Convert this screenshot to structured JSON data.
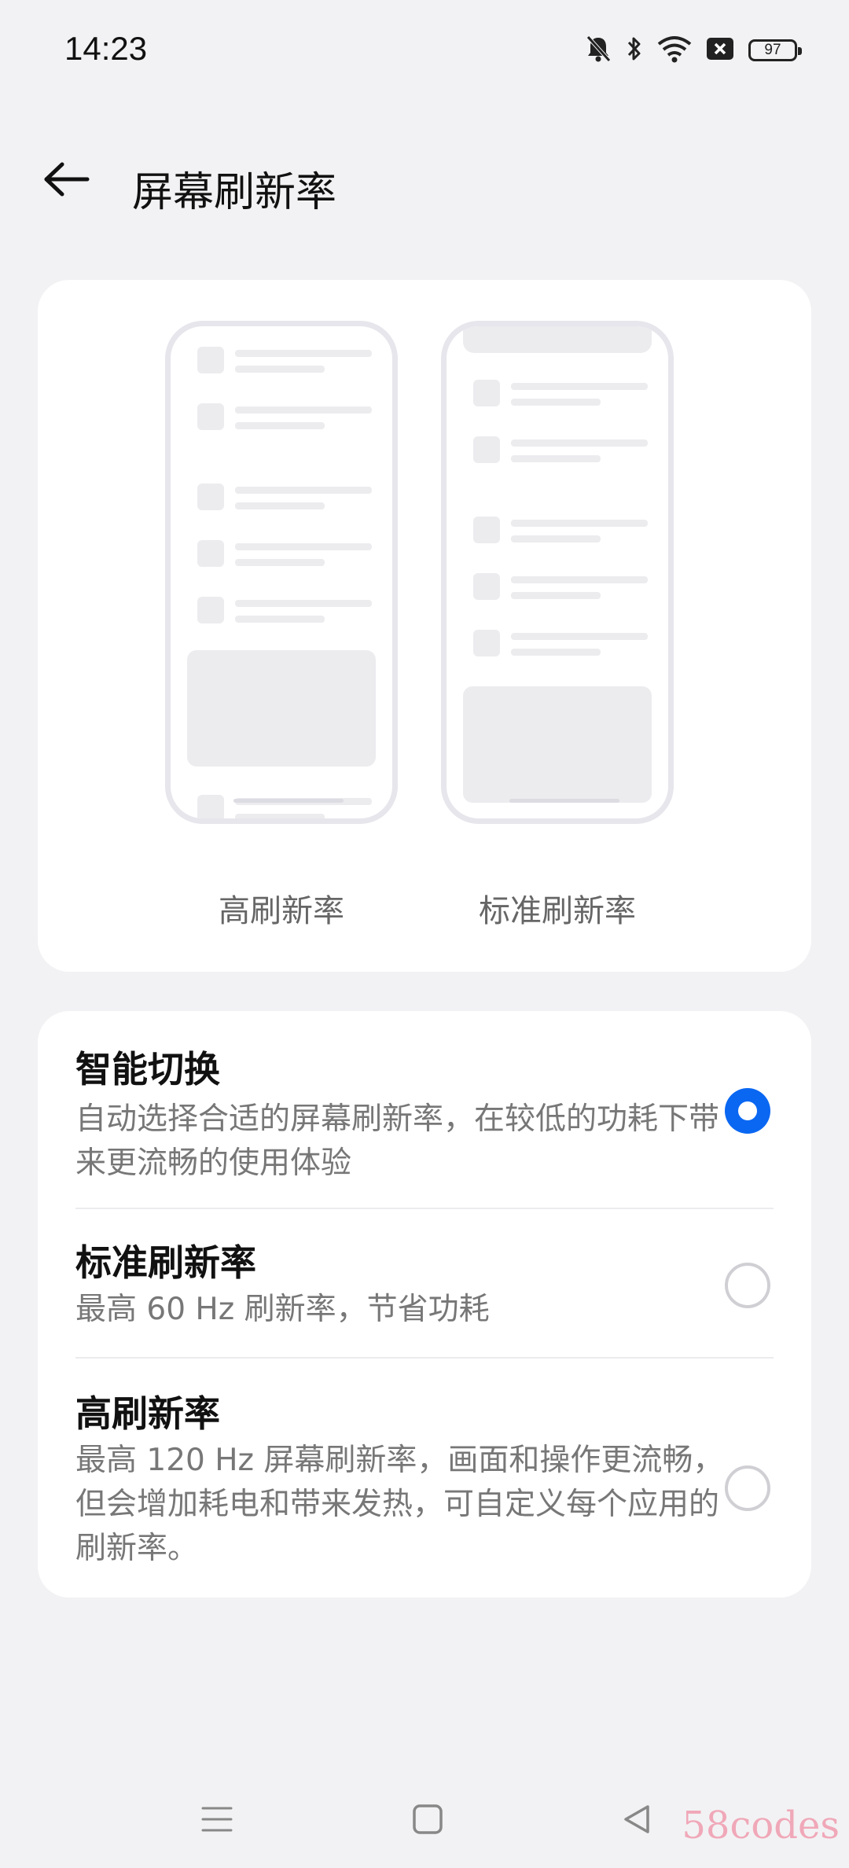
{
  "status_bar": {
    "time": "14:23",
    "battery": "97",
    "icons": [
      "mute-bell-icon",
      "bluetooth-icon",
      "wifi-icon",
      "sim-off-icon",
      "battery-icon"
    ]
  },
  "header": {
    "title": "屏幕刷新率",
    "back_icon": "back-arrow-icon"
  },
  "preview": {
    "high_label": "高刷新率",
    "standard_label": "标准刷新率"
  },
  "options": [
    {
      "title": "智能切换",
      "description": "自动选择合适的屏幕刷新率，在较低的功耗下带来更流畅的使用体验",
      "selected": true
    },
    {
      "title": "标准刷新率",
      "description": "最高 60 Hz 刷新率，节省功耗",
      "selected": false
    },
    {
      "title": "高刷新率",
      "description": "最高 120 Hz 屏幕刷新率，画面和操作更流畅，但会增加耗电和带来发热，可自定义每个应用的刷新率。",
      "selected": false
    }
  ],
  "nav": {
    "icons": [
      "menu-icon",
      "home-icon",
      "back-icon"
    ]
  },
  "watermark": "58codes",
  "colors": {
    "accent": "#0a67f2",
    "background": "#f2f2f4",
    "card": "#ffffff"
  }
}
